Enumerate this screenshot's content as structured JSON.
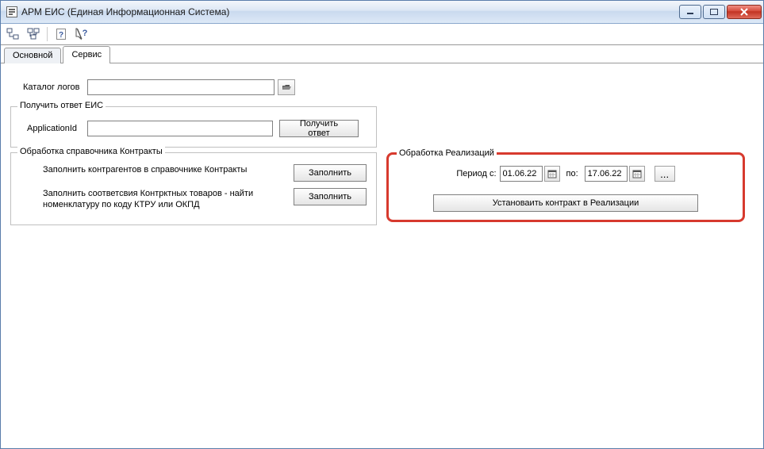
{
  "window": {
    "title": "АРМ ЕИС (Единая Информационная Система)"
  },
  "toolbar": {
    "icons": [
      "tree-icon-1",
      "tree-icon-2",
      "help-icon",
      "context-help-icon"
    ]
  },
  "tabs": {
    "main": "Основной",
    "service": "Сервис"
  },
  "catalog": {
    "label": "Каталог логов",
    "value": ""
  },
  "eis_response": {
    "legend": "Получить ответ ЕИС",
    "appid_label": "ApplicationId",
    "appid_value": "",
    "get_button": "Получить ответ"
  },
  "contracts": {
    "legend": "Обработка справочника Контракты",
    "row1_desc": "Заполнить контрагентов в справочнике Контракты",
    "row1_btn": "Заполнить",
    "row2_desc": "Заполнить соответсвия Контрктных товаров - найти номенклатуру по коду КТРУ или ОКПД",
    "row2_btn": "Заполнить"
  },
  "realizations": {
    "legend": "Обработка Реализаций",
    "period_from_label": "Период с:",
    "period_from": "01.06.22",
    "period_to_label": "по:",
    "period_to": "17.06.22",
    "ellipsis": "...",
    "set_contract_btn": "Установаить контракт в Реализации"
  }
}
